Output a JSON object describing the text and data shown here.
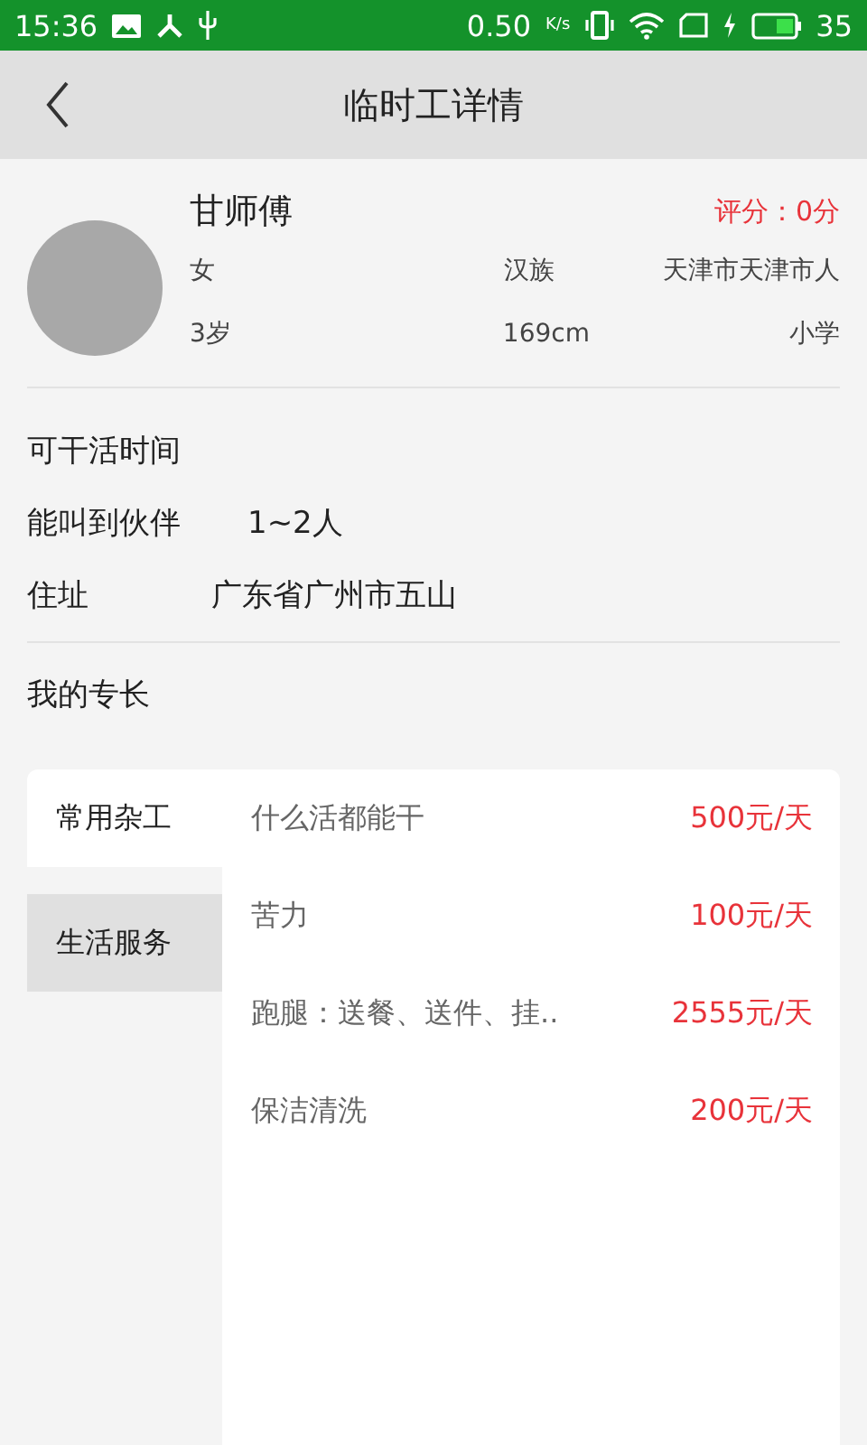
{
  "status_bar": {
    "time": "15:36",
    "speed": "0.50",
    "speed_unit": "K/s",
    "battery": "35"
  },
  "header": {
    "title": "临时工详情"
  },
  "profile": {
    "name": "甘师傅",
    "rating": "评分：0分",
    "gender": "女",
    "ethnicity": "汉族",
    "origin": "天津市天津市人",
    "age": "3岁",
    "height": "169cm",
    "education": "小学"
  },
  "info": [
    {
      "label": "可干活时间"
    },
    {
      "label": "能叫到伙伴",
      "value": "1~2人"
    },
    {
      "label": "住址",
      "value": "广东省广州市五山"
    }
  ],
  "skills_title": "我的专长",
  "categories": [
    {
      "label": "常用杂工",
      "selected": true
    },
    {
      "label": "生活服务",
      "selected": false
    }
  ],
  "skills": [
    {
      "name": "什么活都能干",
      "price": "500元/天"
    },
    {
      "name": "苦力",
      "price": "100元/天"
    },
    {
      "name": "跑腿：送餐、送件、挂..",
      "price": "2555元/天"
    },
    {
      "name": "保洁清洗",
      "price": "200元/天"
    }
  ]
}
